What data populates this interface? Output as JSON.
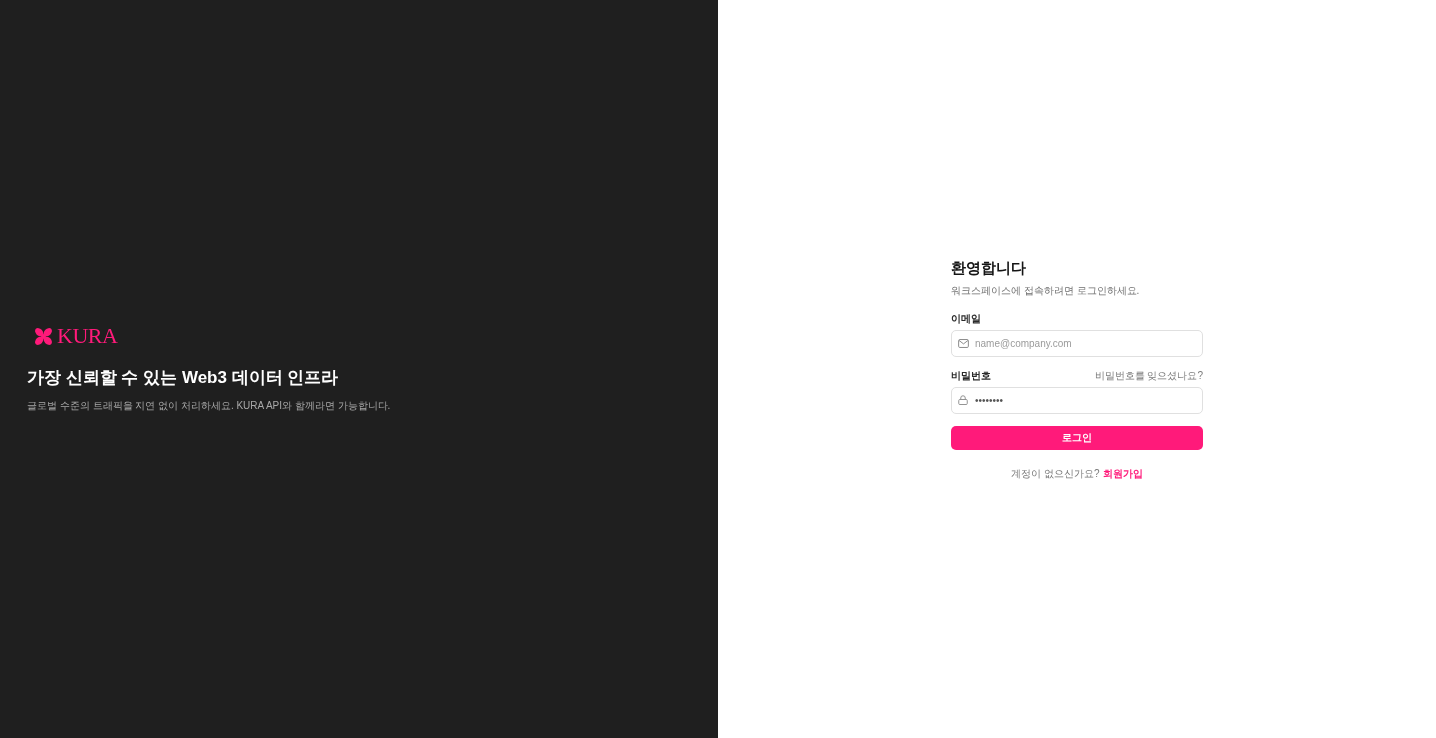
{
  "brand": {
    "name": "KURA"
  },
  "hero": {
    "title": "가장 신뢰할 수 있는 Web3 데이터 인프라",
    "subtitle": "글로벌 수준의 트래픽을 지연 없이 처리하세요. KURA API와 함께라면 가능합니다."
  },
  "login": {
    "title": "환영합니다",
    "subtitle": "워크스페이스에 접속하려면 로그인하세요.",
    "fields": [
      {
        "kind": "email",
        "label": "이메일",
        "placeholder": "name@company.com"
      },
      {
        "kind": "password",
        "label": "비밀번호",
        "value": "••••••••",
        "link": "비밀번호를 잊으셨나요?"
      }
    ],
    "submit": "로그인",
    "signup": {
      "prompt": "계정이 없으신가요?",
      "link": "회원가입"
    }
  }
}
